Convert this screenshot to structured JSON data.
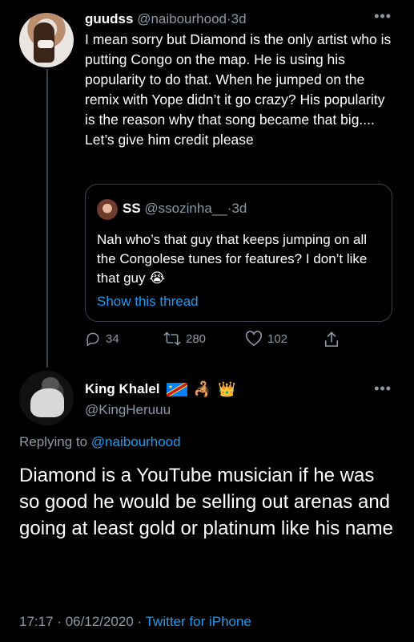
{
  "tweet1": {
    "display_name": "guudss",
    "handle": "@naibourhood",
    "separator": "·",
    "time": "3d",
    "more_icon": "ellipsis-icon",
    "text": "I mean sorry but Diamond is the only artist who is putting Congo on the map. He is using his popularity to do that. When he jumped on the remix with Yope didn’t it go crazy? His popularity is the reason why that song became that big.... Let’s give him credit please",
    "quote": {
      "display_name": "SS",
      "handle": "@ssozinha__",
      "separator": "·",
      "time": "3d",
      "text": "Nah who’s that guy that keeps jumping on all the Congolese tunes for features? I don’t like that guy 😭",
      "show_thread": "Show this thread"
    },
    "actions": {
      "replies": "34",
      "retweets": "280",
      "likes": "102"
    }
  },
  "tweet2": {
    "display_name": "King Khalel",
    "name_emojis": [
      "🦂",
      "👑"
    ],
    "handle": "@KingHeruuu",
    "replying_prefix": "Replying to",
    "replying_to": "@naibourhood",
    "text": "Diamond is a YouTube musician if he was so good he would be selling out arenas and going at least gold or platinum like his name",
    "time": "17:17",
    "meta_sep1": "·",
    "date": "06/12/2020",
    "meta_sep2": "·",
    "source": "Twitter for iPhone"
  },
  "colors": {
    "background": "#000000",
    "text": "#ffffff",
    "muted": "#8b98a5",
    "link": "#1d9bf0",
    "border": "#38444d"
  }
}
